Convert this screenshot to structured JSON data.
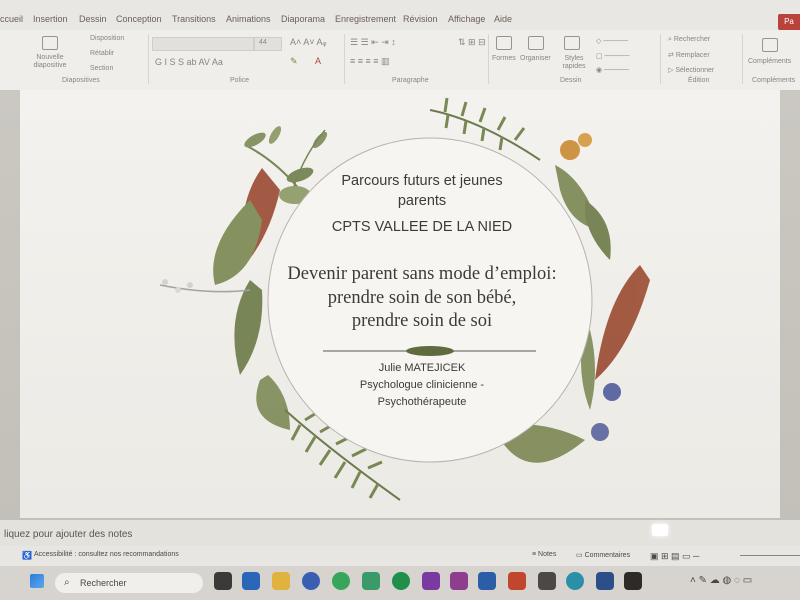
{
  "tabs": [
    "ccueil",
    "Insertion",
    "Dessin",
    "Conception",
    "Transitions",
    "Animations",
    "Diaporama",
    "Enregistrement",
    "Révision",
    "Affichage",
    "Aide"
  ],
  "share_label": "Pa",
  "ribbon": {
    "new_slide_label": "Nouvelle diapositive",
    "layout_label": "Disposition",
    "reset_label": "Rétablir",
    "section_label": "Section",
    "font_size": "44",
    "shapes_label": "Formes",
    "arrange_label": "Organiser",
    "styles_label": "Styles rapides",
    "find_label": "Rechercher",
    "replace_label": "Remplacer",
    "select_label": "Sélectionner",
    "addins_label": "Compléments",
    "groups": {
      "slides": "Diapositives",
      "font": "Police",
      "paragraph": "Paragraphe",
      "drawing": "Dessin",
      "edit": "Édition",
      "addins": "Compléments"
    }
  },
  "slide": {
    "line1": "Parcours futurs et jeunes",
    "line2": "parents",
    "org": "CPTS VALLEE DE LA NIED",
    "title1": "Devenir parent sans mode d’emploi:",
    "title2": "prendre soin de son bébé,",
    "title3": "prendre soin de soi",
    "author": "Julie MATEJICEK",
    "role1": "Psychologue clinicienne -",
    "role2": "Psychothérapeute"
  },
  "notes_placeholder": "liquez pour ajouter des notes",
  "status": {
    "accessibility": "Accessibilité : consultez nos recommandations",
    "notes": "Notes",
    "comments": "Commentaires"
  },
  "taskbar": {
    "search_placeholder": "Rechercher"
  }
}
